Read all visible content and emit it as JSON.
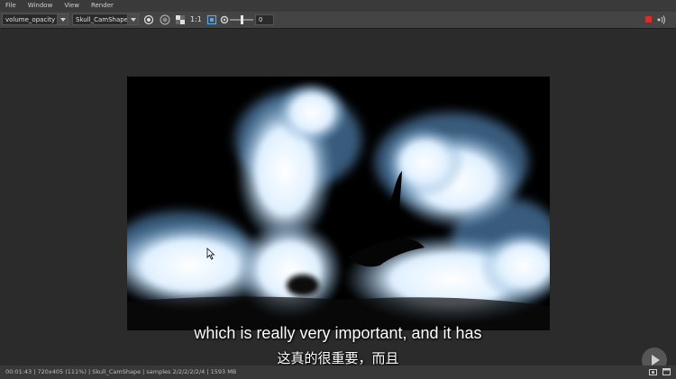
{
  "menubar": {
    "items": [
      {
        "label": "File"
      },
      {
        "label": "Window"
      },
      {
        "label": "View"
      },
      {
        "label": "Render"
      }
    ]
  },
  "toolbar": {
    "aov_select": "volume_opacity",
    "camera_select": "Skull_CamShape",
    "ratio_label": "1:1",
    "exposure_value": "0",
    "stop_color": "#d23030"
  },
  "subtitles": {
    "english": "which is really very important, and it has",
    "chinese": "这真的很重要，而且"
  },
  "statusbar": {
    "text": "00:01:43 | 720x405 (111%) | Skull_CamShape | samples 2/2/2/2/2/4 | 1593 MB"
  }
}
